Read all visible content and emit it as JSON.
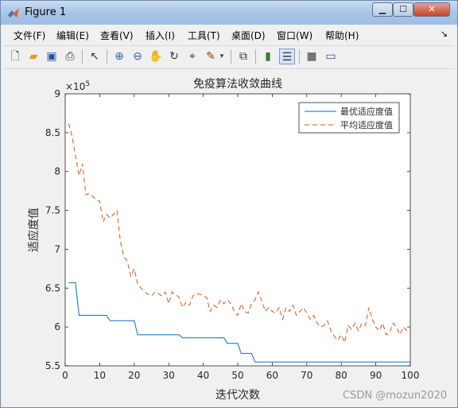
{
  "window": {
    "title": "Figure 1"
  },
  "menu": [
    "文件(F)",
    "编辑(E)",
    "查看(V)",
    "插入(I)",
    "工具(T)",
    "桌面(D)",
    "窗口(W)",
    "帮助(H)"
  ],
  "toolbar": {
    "icons": [
      "new-file-icon",
      "open-folder-icon",
      "save-icon",
      "print-icon",
      "pointer-icon",
      "zoom-in-icon",
      "zoom-out-icon",
      "pan-hand-icon",
      "rotate-3d-icon",
      "data-cursor-icon",
      "brush-icon",
      "brush-dropdown-icon",
      "link-plot-icon",
      "colorbar-icon",
      "legend-icon",
      "hide-plot-tools-icon",
      "show-plot-tools-icon"
    ]
  },
  "chart_data": {
    "type": "line",
    "title": "免疫算法收敛曲线",
    "xlabel": "迭代次数",
    "ylabel": "适应度值",
    "exponent_label": "×10^5",
    "xlim": [
      0,
      100
    ],
    "ylim": [
      5.5,
      9
    ],
    "y_unit_multiplier": 100000,
    "xticks": [
      0,
      10,
      20,
      30,
      40,
      50,
      60,
      70,
      80,
      90,
      100
    ],
    "yticks": [
      5.5,
      6,
      6.5,
      7,
      7.5,
      8,
      8.5,
      9
    ],
    "legend_position": "top-right",
    "series": [
      {
        "name": "最优适应度值",
        "style": "solid",
        "color": "#0072bd",
        "x": [
          1,
          2,
          3,
          4,
          5,
          6,
          7,
          8,
          9,
          10,
          11,
          12,
          13,
          14,
          15,
          16,
          17,
          18,
          19,
          20,
          21,
          22,
          23,
          24,
          25,
          26,
          27,
          28,
          29,
          30,
          31,
          32,
          33,
          34,
          35,
          36,
          37,
          38,
          39,
          40,
          41,
          42,
          43,
          44,
          45,
          46,
          47,
          48,
          49,
          50,
          51,
          52,
          53,
          54,
          55,
          56,
          57,
          58,
          59,
          60,
          61,
          62,
          63,
          64,
          65,
          66,
          67,
          68,
          69,
          70,
          71,
          72,
          73,
          74,
          75,
          76,
          77,
          78,
          79,
          80,
          81,
          82,
          83,
          84,
          85,
          86,
          87,
          88,
          89,
          90,
          91,
          92,
          93,
          94,
          95,
          96,
          97,
          98,
          99,
          100
        ],
        "y": [
          6.57,
          6.57,
          6.57,
          6.15,
          6.15,
          6.15,
          6.15,
          6.15,
          6.15,
          6.15,
          6.15,
          6.15,
          6.08,
          6.08,
          6.08,
          6.08,
          6.08,
          6.08,
          6.08,
          6.08,
          5.9,
          5.9,
          5.9,
          5.9,
          5.9,
          5.9,
          5.9,
          5.9,
          5.9,
          5.9,
          5.9,
          5.9,
          5.9,
          5.86,
          5.86,
          5.86,
          5.86,
          5.86,
          5.86,
          5.86,
          5.86,
          5.86,
          5.86,
          5.86,
          5.86,
          5.86,
          5.79,
          5.79,
          5.79,
          5.79,
          5.66,
          5.66,
          5.66,
          5.66,
          5.55,
          5.55,
          5.55,
          5.55,
          5.55,
          5.55,
          5.55,
          5.55,
          5.55,
          5.55,
          5.55,
          5.55,
          5.55,
          5.55,
          5.55,
          5.55,
          5.55,
          5.55,
          5.55,
          5.55,
          5.55,
          5.55,
          5.55,
          5.55,
          5.55,
          5.55,
          5.55,
          5.55,
          5.55,
          5.55,
          5.55,
          5.55,
          5.55,
          5.55,
          5.55,
          5.55,
          5.55,
          5.55,
          5.55,
          5.55,
          5.55,
          5.55,
          5.55,
          5.55,
          5.55,
          5.55
        ]
      },
      {
        "name": "平均适应度值",
        "style": "dashed",
        "color": "#d95319",
        "x": [
          1,
          2,
          3,
          4,
          5,
          6,
          7,
          8,
          9,
          10,
          11,
          12,
          13,
          14,
          15,
          16,
          17,
          18,
          19,
          20,
          21,
          22,
          23,
          24,
          25,
          26,
          27,
          28,
          29,
          30,
          31,
          32,
          33,
          34,
          35,
          36,
          37,
          38,
          39,
          40,
          41,
          42,
          43,
          44,
          45,
          46,
          47,
          48,
          49,
          50,
          51,
          52,
          53,
          54,
          55,
          56,
          57,
          58,
          59,
          60,
          61,
          62,
          63,
          64,
          65,
          66,
          67,
          68,
          69,
          70,
          71,
          72,
          73,
          74,
          75,
          76,
          77,
          78,
          79,
          80,
          81,
          82,
          83,
          84,
          85,
          86,
          87,
          88,
          89,
          90,
          91,
          92,
          93,
          94,
          95,
          96,
          97,
          98,
          99,
          100
        ],
        "y": [
          8.62,
          8.45,
          8.2,
          7.95,
          8.1,
          7.7,
          7.72,
          7.68,
          7.63,
          7.62,
          7.35,
          7.45,
          7.4,
          7.45,
          7.5,
          7.1,
          6.9,
          6.85,
          6.65,
          6.75,
          6.55,
          6.5,
          6.45,
          6.42,
          6.4,
          6.45,
          6.43,
          6.4,
          6.45,
          6.3,
          6.45,
          6.42,
          6.38,
          6.25,
          6.32,
          6.28,
          6.4,
          6.43,
          6.42,
          6.4,
          6.38,
          6.2,
          6.28,
          6.25,
          6.35,
          6.3,
          6.35,
          6.3,
          6.2,
          6.15,
          6.3,
          6.2,
          6.18,
          6.3,
          6.35,
          6.45,
          6.33,
          6.2,
          6.25,
          6.2,
          6.18,
          6.25,
          6.1,
          6.25,
          6.2,
          6.28,
          6.15,
          6.2,
          6.25,
          6.18,
          6.1,
          6.15,
          6.05,
          6.0,
          6.02,
          6.08,
          5.95,
          5.88,
          5.83,
          5.9,
          5.8,
          6.02,
          5.97,
          6.05,
          5.95,
          6.05,
          6.02,
          6.25,
          6.1,
          6.0,
          5.95,
          6.05,
          5.9,
          5.92,
          6.05,
          6.0,
          5.9,
          6.0,
          5.95,
          5.95
        ]
      }
    ]
  },
  "watermark": "CSDN @mozun2020"
}
